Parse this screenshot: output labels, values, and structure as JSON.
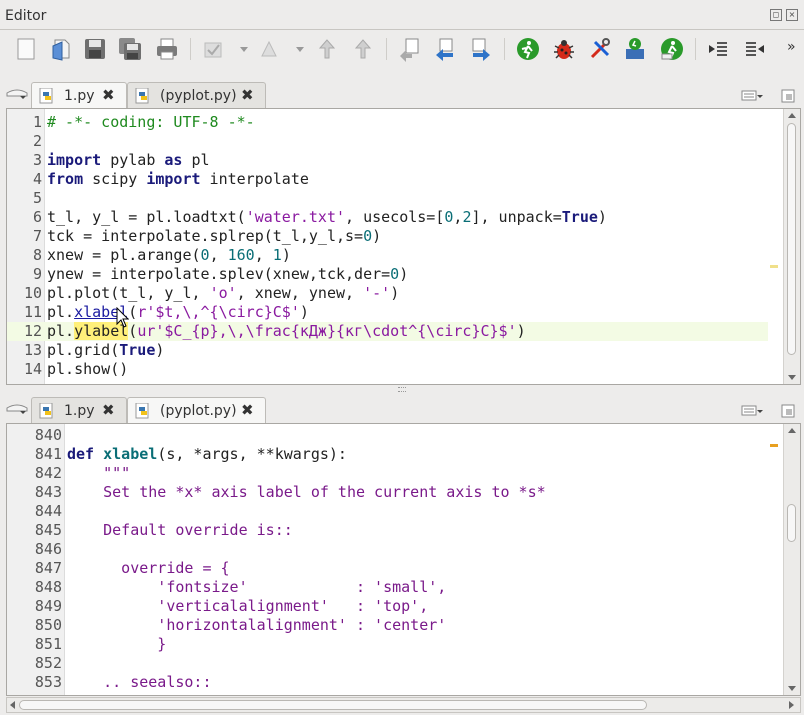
{
  "window": {
    "title": "Editor"
  },
  "toolbar": {
    "icons": [
      "new-file-icon",
      "open-file-icon",
      "save-icon",
      "save-all-icon",
      "print-icon",
      "checklist-icon",
      "bookmark-icon",
      "previous-warning-icon",
      "next-warning-icon",
      "last-edit-icon",
      "previous-cursor-icon",
      "next-cursor-icon",
      "run-icon",
      "debug-icon",
      "configure-icon",
      "run-selection-icon",
      "re-run-icon",
      "indent-icon",
      "unindent-icon"
    ],
    "more_label": "»"
  },
  "top_tabs": [
    {
      "label": "1.py",
      "close": "✖",
      "active": true
    },
    {
      "label": "(pyplot.py)",
      "close": "✖",
      "active": false
    }
  ],
  "bottom_tabs": [
    {
      "label": "1.py",
      "close": "✖",
      "active": false
    },
    {
      "label": "(pyplot.py)",
      "close": "✖",
      "active": true
    }
  ],
  "top_editor": {
    "lines": [
      {
        "n": "1",
        "text": "# -*- coding: UTF-8 -*-"
      },
      {
        "n": "2",
        "text": ""
      },
      {
        "n": "3",
        "text": "import pylab as pl"
      },
      {
        "n": "4",
        "text": "from scipy import interpolate"
      },
      {
        "n": "5",
        "text": ""
      },
      {
        "n": "6",
        "text": "t_l, y_l = pl.loadtxt('water.txt', usecols=[0,2], unpack=True)"
      },
      {
        "n": "7",
        "text": "tck = interpolate.splrep(t_l,y_l,s=0)"
      },
      {
        "n": "8",
        "text": "xnew = pl.arange(0, 160, 1)"
      },
      {
        "n": "9",
        "text": "ynew = interpolate.splev(xnew,tck,der=0)"
      },
      {
        "n": "10",
        "text": "pl.plot(t_l, y_l, 'o', xnew, ynew, '-')"
      },
      {
        "n": "11",
        "text": "pl.xlabel(r'$t,\\,^{\\circ}C$')"
      },
      {
        "n": "12",
        "text": "pl.ylabel(ur'$C_{p},\\,\\frac{кДж}{кг\\cdot^{\\circ}C}$')"
      },
      {
        "n": "13",
        "text": "pl.grid(True)"
      },
      {
        "n": "14",
        "text": "pl.show()"
      }
    ]
  },
  "bottom_editor": {
    "lines": [
      {
        "n": "840",
        "text": ""
      },
      {
        "n": "841",
        "text": "def xlabel(s, *args, **kwargs):"
      },
      {
        "n": "842",
        "text": "    \"\"\""
      },
      {
        "n": "843",
        "text": "    Set the *x* axis label of the current axis to *s*"
      },
      {
        "n": "844",
        "text": ""
      },
      {
        "n": "845",
        "text": "    Default override is::"
      },
      {
        "n": "846",
        "text": ""
      },
      {
        "n": "847",
        "text": "      override = {"
      },
      {
        "n": "848",
        "text": "          'fontsize'            : 'small',"
      },
      {
        "n": "849",
        "text": "          'verticalalignment'   : 'top',"
      },
      {
        "n": "850",
        "text": "          'horizontalalignment' : 'center'"
      },
      {
        "n": "851",
        "text": "          }"
      },
      {
        "n": "852",
        "text": ""
      },
      {
        "n": "853",
        "text": "    .. seealso::"
      }
    ]
  },
  "colors": {
    "keyword": "#1a1a7a",
    "comment": "#1f8a1f",
    "string": "#8a1aa0",
    "number": "#0a6e76",
    "highlight": "#fff07a",
    "current_line": "#f3fbe4"
  }
}
